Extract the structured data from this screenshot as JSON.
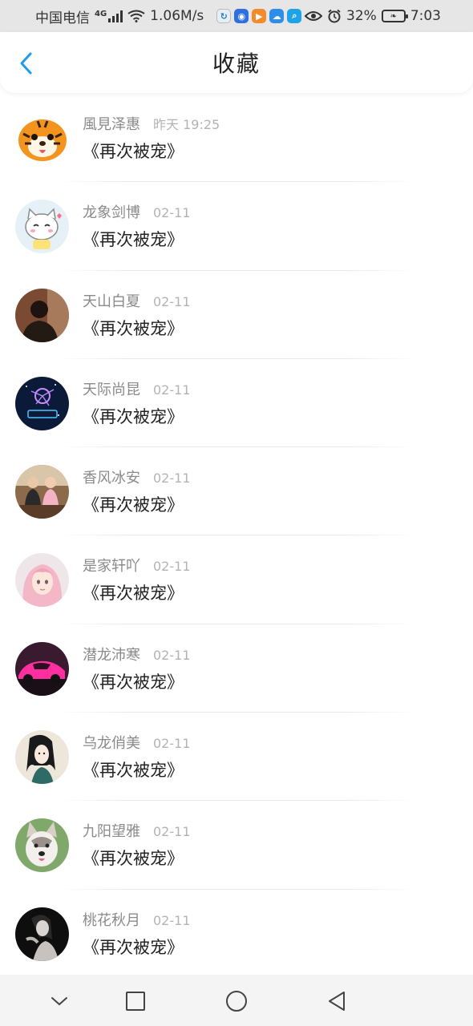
{
  "status_bar": {
    "carrier": "中国电信",
    "network": "4G",
    "speed": "1.06M/s",
    "battery": "32%",
    "time": "7:03",
    "app_icons": [
      "sync-app-icon",
      "bulb-app-icon",
      "video-app-icon",
      "weather-app-icon",
      "search-app-icon"
    ]
  },
  "header": {
    "title": "收藏"
  },
  "items": [
    {
      "name": "風見泽惠",
      "time": "昨天 19:25",
      "title": "《再次被宠》",
      "avatar": "tiger-cartoon-avatar"
    },
    {
      "name": "龙象剑博",
      "time": "02-11",
      "title": "《再次被宠》",
      "avatar": "cat-cartoon-avatar"
    },
    {
      "name": "天山白夏",
      "time": "02-11",
      "title": "《再次被宠》",
      "avatar": "person-silhouette-avatar"
    },
    {
      "name": "天际尚昆",
      "time": "02-11",
      "title": "《再次被宠》",
      "avatar": "constellation-avatar"
    },
    {
      "name": "香风冰安",
      "time": "02-11",
      "title": "《再次被宠》",
      "avatar": "group-photo-avatar"
    },
    {
      "name": "是家轩吖",
      "time": "02-11",
      "title": "《再次被宠》",
      "avatar": "anime-girl-avatar"
    },
    {
      "name": "潜龙沛寒",
      "time": "02-11",
      "title": "《再次被宠》",
      "avatar": "pink-car-avatar"
    },
    {
      "name": "乌龙俏美",
      "time": "02-11",
      "title": "《再次被宠》",
      "avatar": "ink-girl-avatar"
    },
    {
      "name": "九阳望雅",
      "time": "02-11",
      "title": "《再次被宠》",
      "avatar": "husky-dog-avatar"
    },
    {
      "name": "桃花秋月",
      "time": "02-11",
      "title": "《再次被宠》",
      "avatar": "dark-portrait-avatar"
    }
  ],
  "nav_bar": {
    "buttons": [
      "chevron-down-icon",
      "recent-apps-icon",
      "home-icon",
      "back-triangle-icon"
    ]
  },
  "colors": {
    "accent": "#1e9bf0",
    "status_bar_bg": "#e6e6e6",
    "name_text": "#8a8a8a",
    "time_text": "#b3b3b3",
    "title_text": "#222222"
  }
}
